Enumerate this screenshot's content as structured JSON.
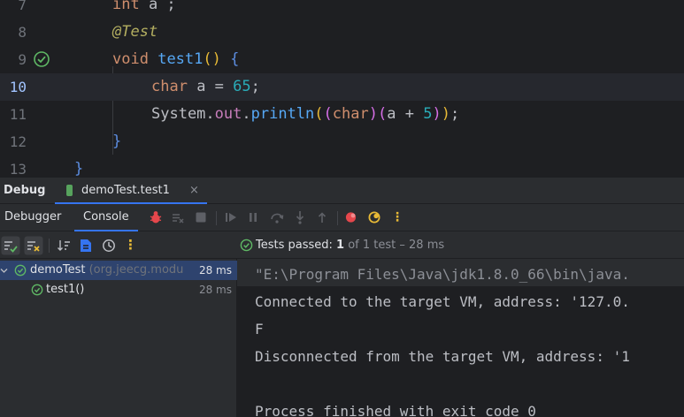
{
  "editor": {
    "lines": [
      {
        "num": "7"
      },
      {
        "num": "8"
      },
      {
        "num": "9"
      },
      {
        "num": "10"
      },
      {
        "num": "11"
      },
      {
        "num": "12"
      },
      {
        "num": "13"
      }
    ],
    "code": {
      "l7_kw": "int",
      "l7_rest": " a ;",
      "l8_ann": "@Test",
      "l9_kw": "void",
      "l9_fn": "test1",
      "l9_p": "()",
      "l9_b": " {",
      "l10_kw": "char",
      "l10_mid": " a = ",
      "l10_num": "65",
      "l10_end": ";",
      "l11_cls": "System.",
      "l11_field": "out",
      "l11_dot": ".",
      "l11_fn": "println",
      "l11_p1": "(",
      "l11_p2": "(",
      "l11_kw": "char",
      "l11_p2c": ")",
      "l11_p3": "(",
      "l11_expr": "a + ",
      "l11_num": "5",
      "l11_p3c": ")",
      "l11_p1c": ")",
      "l11_end": ";",
      "l12_b": "}",
      "l13_b": "}"
    }
  },
  "tool_window": {
    "title": "Debug",
    "run_tab": "demoTest.test1",
    "close_glyph": "×"
  },
  "debug_toolbar": {
    "tabs": [
      "Debugger",
      "Console"
    ]
  },
  "status": {
    "prefix": "Tests passed: ",
    "passed": "1",
    "of": " of 1 test – 28 ms"
  },
  "tree": {
    "root": {
      "name": "demoTest",
      "package": "(org.jeecg.modu",
      "duration": "28 ms"
    },
    "child": {
      "name": "test1()",
      "duration": "28 ms"
    }
  },
  "console": {
    "lines": [
      "\"E:\\Program Files\\Java\\jdk1.8.0_66\\bin\\java.",
      "Connected to the target VM, address: '127.0.",
      "F",
      "Disconnected from the target VM, address: '1",
      "",
      "Process finished with exit code 0"
    ]
  },
  "colors": {
    "accent": "#3574f0",
    "success": "#5fb865",
    "breakpoint": "#e5474c"
  }
}
